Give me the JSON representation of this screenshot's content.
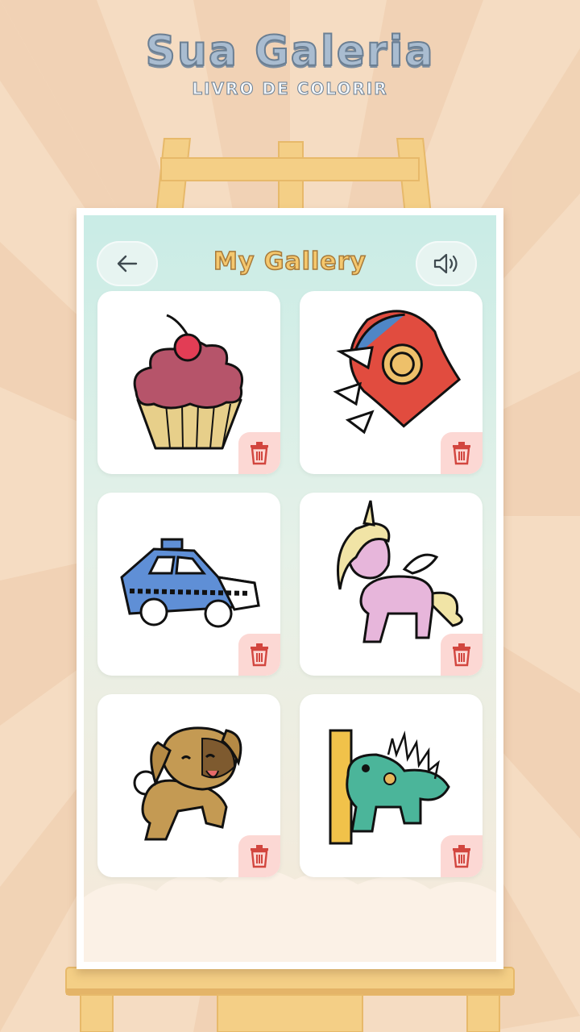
{
  "header": {
    "title": "Sua Galeria",
    "subtitle": "LIVRO DE COLORIR"
  },
  "panel": {
    "title": "My Gallery",
    "back_icon": "arrow-left-icon",
    "sound_icon": "speaker-icon"
  },
  "gallery": {
    "items": [
      {
        "name": "cupcake",
        "delete_icon": "trash-icon"
      },
      {
        "name": "rocket",
        "delete_icon": "trash-icon"
      },
      {
        "name": "police-car",
        "delete_icon": "trash-icon"
      },
      {
        "name": "unicorn",
        "delete_icon": "trash-icon"
      },
      {
        "name": "puppy",
        "delete_icon": "trash-icon"
      },
      {
        "name": "iguana",
        "delete_icon": "trash-icon"
      }
    ]
  },
  "colors": {
    "background": "#f5dcc2",
    "easel_wood": "#f4cf86",
    "title_fill": "#f5c86e",
    "delete_bg": "#fcd8d4",
    "delete_icon": "#d2463f"
  }
}
